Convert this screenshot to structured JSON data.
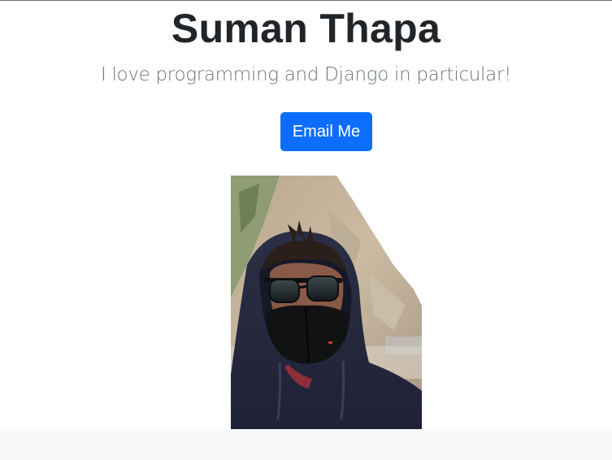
{
  "hero": {
    "title": "Suman Thapa",
    "lead": "I love programming and Django in particular!",
    "button_label": "Email Me"
  },
  "colors": {
    "primary_button": "#0d6efd",
    "title_text": "#212529",
    "lead_text": "#6c757d",
    "footer_background": "#f8f9fa"
  },
  "photo": {
    "subject": "selfie-hooded-sunglasses-mask"
  }
}
